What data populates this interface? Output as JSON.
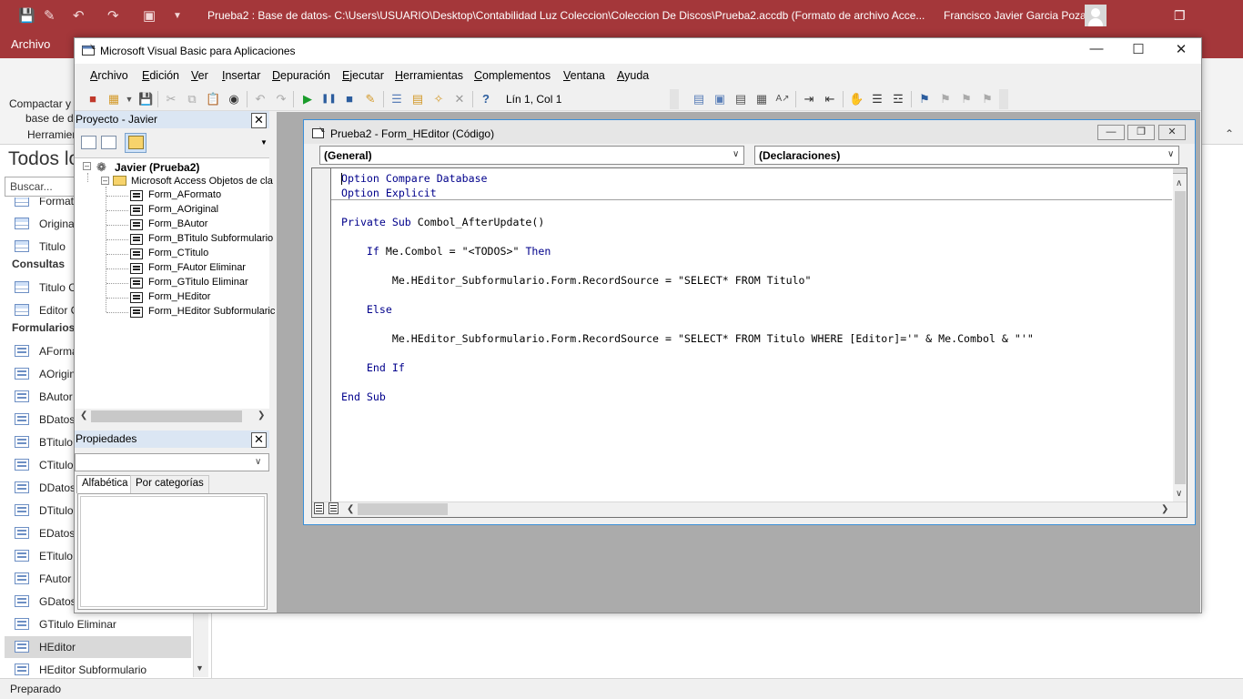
{
  "access": {
    "title": "Prueba2 : Base de datos- C:\\Users\\USUARIO\\Desktop\\Contabilidad Luz Coleccion\\Coleccion De Discos\\Prueba2.accdb (Formato de archivo Acce...",
    "user": "Francisco Javier Garcia Poza",
    "file_tab": "Archivo",
    "compact_line1": "Compactar y",
    "compact_line2": "base de da",
    "tools_group": "Herramien",
    "nav_title": "Todos lo",
    "search_placeholder": "Buscar...",
    "nav_items": [
      {
        "label": "Formato",
        "kind": "table"
      },
      {
        "label": "Original",
        "kind": "table"
      },
      {
        "label": "Titulo",
        "kind": "table"
      },
      {
        "label": "Titulo C",
        "kind": "query"
      },
      {
        "label": "Editor C",
        "kind": "query"
      },
      {
        "label": "AFormato",
        "kind": "form"
      },
      {
        "label": "AOriginal",
        "kind": "form"
      },
      {
        "label": "BAutor",
        "kind": "form"
      },
      {
        "label": "BDatos",
        "kind": "form"
      },
      {
        "label": "BTitulo",
        "kind": "form"
      },
      {
        "label": "CTitulo",
        "kind": "form"
      },
      {
        "label": "DDatos",
        "kind": "form"
      },
      {
        "label": "DTitulo",
        "kind": "form"
      },
      {
        "label": "EDatos",
        "kind": "form"
      },
      {
        "label": "ETitulo",
        "kind": "form"
      },
      {
        "label": "FAutor",
        "kind": "form"
      },
      {
        "label": "GDatos",
        "kind": "form"
      },
      {
        "label": "GTitulo Eliminar",
        "kind": "form"
      },
      {
        "label": "HEditor",
        "kind": "form",
        "selected": true
      },
      {
        "label": "HEditor Subformulario",
        "kind": "form"
      }
    ],
    "cat_consultas": "Consultas",
    "cat_formularios": "Formularios",
    "status": "Preparado"
  },
  "vba": {
    "title": "Microsoft Visual Basic para Aplicaciones",
    "menus": [
      {
        "u": "A",
        "rest": "rchivo"
      },
      {
        "u": "E",
        "rest": "dición"
      },
      {
        "u": "V",
        "rest": "er"
      },
      {
        "u": "I",
        "rest": "nsertar"
      },
      {
        "u": "D",
        "rest": "epuración"
      },
      {
        "u": "E",
        "rest": "jecutar"
      },
      {
        "u": "H",
        "rest": "erramientas"
      },
      {
        "u": "C",
        "rest": "omplementos"
      },
      {
        "u": "V",
        "rest": "entana"
      },
      {
        "u": "A",
        "rest": "yuda"
      }
    ],
    "cursor_pos": "Lín 1, Col 1",
    "project_title": "Proyecto - Javier",
    "project_root": "Javier (Prueba2)",
    "project_folder": "Microsoft Access Objetos de cla",
    "modules": [
      "Form_AFormato",
      "Form_AOriginal",
      "Form_BAutor",
      "Form_BTitulo Subformulario",
      "Form_CTitulo",
      "Form_FAutor Eliminar",
      "Form_GTitulo Eliminar",
      "Form_HEditor",
      "Form_HEditor Subformularic"
    ],
    "props_title": "Propiedades",
    "props_tab_alpha": "Alfabética",
    "props_tab_cat": "Por categorías",
    "code_window_title": "Prueba2 - Form_HEditor (Código)",
    "object_combo": "(General)",
    "proc_combo": "(Declaraciones)",
    "code_decl": [
      [
        {
          "t": "Option Compare Database",
          "k": true
        }
      ],
      [
        {
          "t": "Option Explicit",
          "k": true
        }
      ]
    ],
    "code_lines": [
      [
        {
          "t": "",
          "k": false
        }
      ],
      [
        {
          "t": "Private Sub",
          "k": true
        },
        {
          "t": " Combol_AfterUpdate()",
          "k": false
        }
      ],
      [
        {
          "t": "",
          "k": false
        }
      ],
      [
        {
          "t": "    ",
          "k": false
        },
        {
          "t": "If",
          "k": true
        },
        {
          "t": " Me.Combol = \"<TODOS>\" ",
          "k": false
        },
        {
          "t": "Then",
          "k": true
        }
      ],
      [
        {
          "t": "",
          "k": false
        }
      ],
      [
        {
          "t": "        Me.HEditor_Subformulario.Form.RecordSource = \"SELECT* FROM Titulo\"",
          "k": false
        }
      ],
      [
        {
          "t": "",
          "k": false
        }
      ],
      [
        {
          "t": "    ",
          "k": false
        },
        {
          "t": "Else",
          "k": true
        }
      ],
      [
        {
          "t": "",
          "k": false
        }
      ],
      [
        {
          "t": "        Me.HEditor_Subformulario.Form.RecordSource = \"SELECT* FROM Titulo WHERE [Editor]='\" & Me.Combol & \"'\"",
          "k": false
        }
      ],
      [
        {
          "t": "",
          "k": false
        }
      ],
      [
        {
          "t": "    ",
          "k": false
        },
        {
          "t": "End If",
          "k": true
        }
      ],
      [
        {
          "t": "",
          "k": false
        }
      ],
      [
        {
          "t": "End Sub",
          "k": true
        }
      ]
    ]
  }
}
